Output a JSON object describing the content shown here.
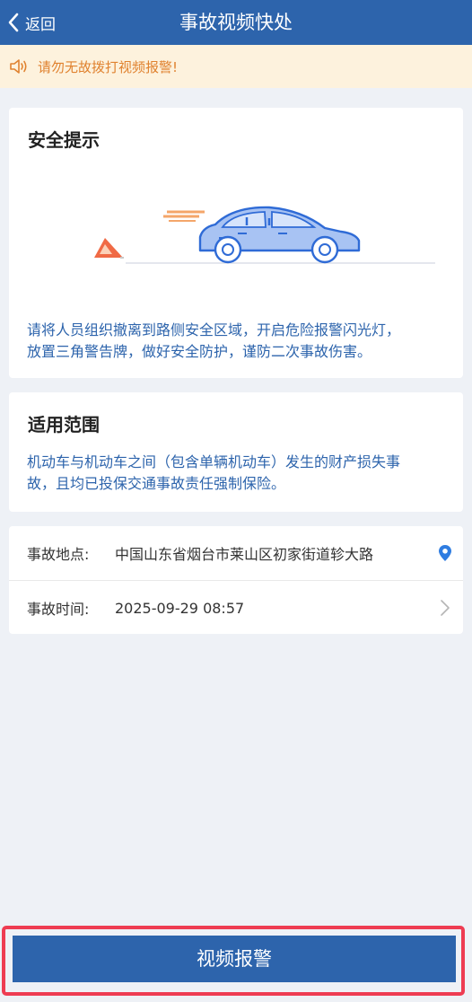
{
  "header": {
    "back_label": "返回",
    "title": "事故视频快处"
  },
  "notice": {
    "text": "请勿无故拨打视频报警!"
  },
  "safety": {
    "title": "安全提示",
    "tip_line1": "请将人员组织撤离到路侧安全区域，开启危险报警闪光灯，",
    "tip_line2": "放置三角警告牌，做好安全防护，谨防二次事故伤害。"
  },
  "scope": {
    "title": "适用范围",
    "line1": "机动车与机动车之间（包含单辆机动车）发生的财产损失事",
    "line2": "故，且均已投保交通事故责任强制保险。"
  },
  "info": {
    "location_label": "事故地点:",
    "location_value": "中国山东省烟台市莱山区初家街道轸大路",
    "time_label": "事故时间:",
    "time_value": "2025-09-29 08:57"
  },
  "submit": {
    "label": "视频报警"
  },
  "colors": {
    "primary": "#2d64ac",
    "notice_bg": "#fdf2dd",
    "notice_text": "#e0822f",
    "highlight": "#ee3c52"
  }
}
